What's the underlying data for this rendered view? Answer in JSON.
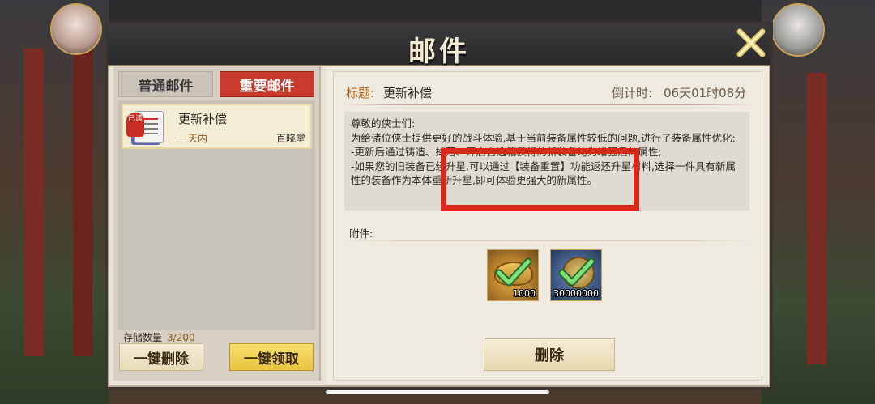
{
  "window": {
    "title": "邮件"
  },
  "tabs": {
    "normal": "普通邮件",
    "important": "重要邮件"
  },
  "mail_list": {
    "items": [
      {
        "read_badge": "已读",
        "title": "更新补偿",
        "time": "一天内",
        "sender": "百晓堂"
      }
    ]
  },
  "storage": {
    "label": "存储数量",
    "count": "3/200"
  },
  "buttons": {
    "delete_all": "一键删除",
    "collect_all": "一键领取",
    "delete": "删除"
  },
  "detail": {
    "subject_label": "标题:",
    "subject": "更新补偿",
    "countdown_label": "倒计时:",
    "countdown": "06天01时08分",
    "body_lines": [
      "尊敬的侠士们:",
      "为给诸位侠士提供更好的战斗体验,基于当前装备属性较低的问题,进行了装备属性优化:",
      "-更新后通过铸造、掉落、开启自选箱获得的新装备均为增强后的属性;",
      "-如果您的旧装备已经升星,可以通过【装备重置】功能返还升星材料,选择一件具有新属性的装备作为本体重新升星,即可体验更强大的新属性。"
    ],
    "attachments_label": "附件:",
    "attachments": [
      {
        "icon": "gold-ingot-icon",
        "quantity": "1000",
        "claimed": true
      },
      {
        "icon": "copper-coin-icon",
        "quantity": "30000000",
        "claimed": true
      }
    ]
  },
  "colors": {
    "accent_red": "#c73a2c",
    "highlight_border": "#d9271a",
    "gold_button": "#e9c33e"
  }
}
